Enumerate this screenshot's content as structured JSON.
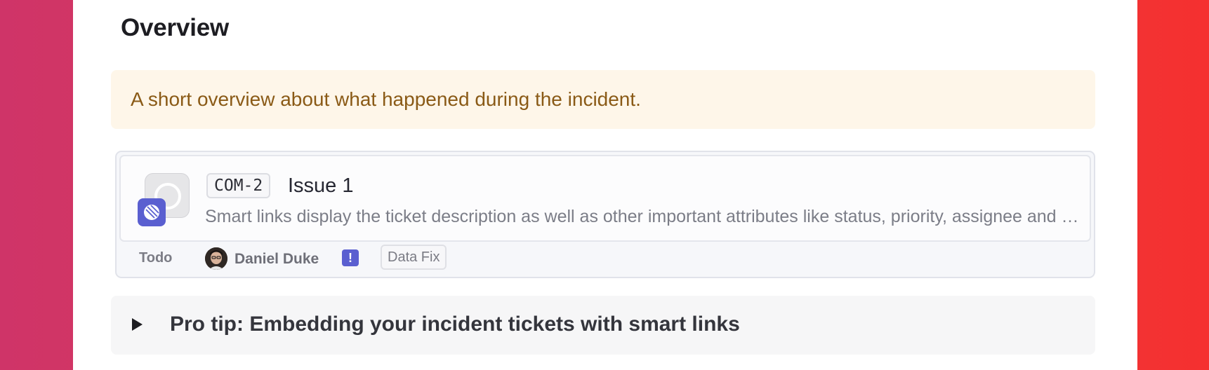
{
  "section": {
    "heading": "Overview"
  },
  "callout": {
    "text": "A short overview about what happened during the incident."
  },
  "smart_link": {
    "app_icon": "linear-icon",
    "ticket_id": "COM-2",
    "title": "Issue 1",
    "description": "Smart links display the ticket description as well as other important attributes like status, priority, assignee and labels.",
    "status": "Todo",
    "assignee": "Daniel Duke",
    "priority_icon": "urgent-priority-icon",
    "priority_symbol": "!",
    "label": "Data Fix"
  },
  "toggle": {
    "icon": "triangle-right-icon",
    "text": "Pro tip: Embedding your incident tickets with smart links"
  },
  "colors": {
    "background_left": "#cf3468",
    "background_right": "#f5302f",
    "callout_bg": "#fef6e9",
    "callout_text": "#8a5a16",
    "linear_accent": "#5a5fd0"
  }
}
